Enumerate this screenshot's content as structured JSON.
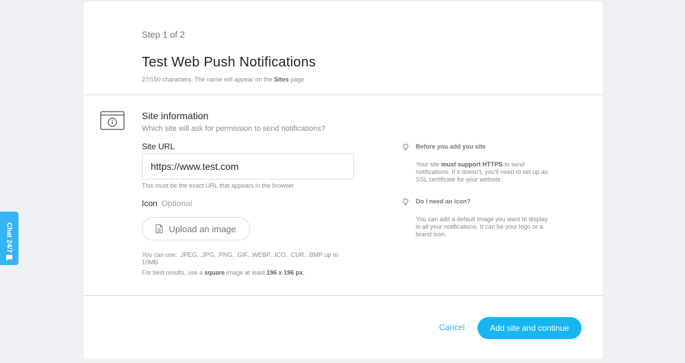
{
  "header": {
    "step": "Step 1 of 2",
    "title": "Test Web Push Notifications",
    "subtitle_prefix": "27/150 characters. The name will appear on the ",
    "subtitle_bold": "Sites",
    "subtitle_suffix": " page"
  },
  "site_info": {
    "title": "Site information",
    "subtitle": "Which site will ask for permission to send notifications?",
    "url_label": "Site URL",
    "url_value": "https://www.test.com",
    "url_hint": "This must be the exact URL that appears in the browser",
    "icon_label": "Icon",
    "icon_optional": "Optional",
    "upload_label": "Upload an image",
    "formats": "You can use: .JPEG, .JPG, .PNG, .GIF, .WEBP, .ICO, .CUR, .BMP up to 10MB",
    "best_prefix": "For best results, use a ",
    "best_bold1": "square",
    "best_mid": " image at least ",
    "best_bold2": "196 x 196 px",
    "best_suffix": "."
  },
  "tips": {
    "tip1_title": "Before you add you site",
    "tip1_prefix": "Your site ",
    "tip1_bold": "must support HTTPS",
    "tip1_suffix": " to send notifications. If it doesn't, you'll need to set up an SSL certificate for your website.",
    "tip2_title": "Do I need an icon?",
    "tip2_body": "You can add a default image you want to display in all your notifications. It can be your logo or a brand icon."
  },
  "footer": {
    "cancel_label": "Cancel",
    "primary_label": "Add site and continue"
  },
  "chat": {
    "label": "Chat 24/7"
  },
  "colors": {
    "accent": "#17b6f2",
    "link": "#2cb3ea",
    "background": "#eef0f3"
  },
  "icons": [
    "browser-info-icon",
    "lightbulb-icon",
    "document-icon",
    "chat-bubble-icon"
  ]
}
